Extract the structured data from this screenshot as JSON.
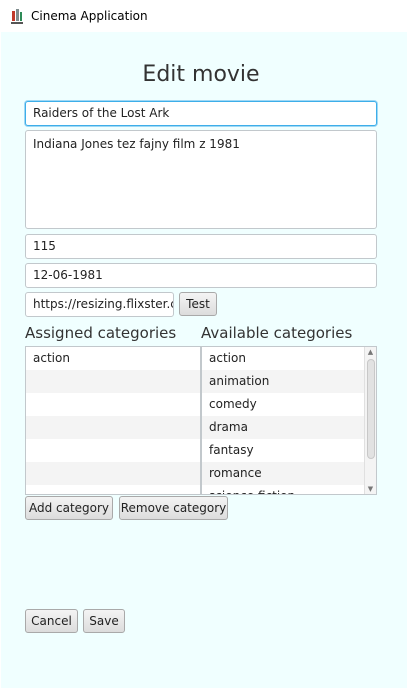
{
  "window": {
    "title": "Cinema Application",
    "icon": "cinema-app-icon"
  },
  "form": {
    "heading": "Edit movie",
    "title_value": "Raiders of the Lost Ark",
    "description_value": "Indiana Jones tez fajny film z 1981",
    "duration_value": "115",
    "release_date_value": "12-06-1981",
    "image_url_value": "https://resizing.flixster.com",
    "test_label": "Test"
  },
  "categories": {
    "assigned_label": "Assigned categories",
    "available_label": "Available categories",
    "assigned": [
      "action"
    ],
    "available": [
      "action",
      "animation",
      "comedy",
      "drama",
      "fantasy",
      "romance",
      "science fiction"
    ],
    "add_label": "Add category",
    "remove_label": "Remove category"
  },
  "actions": {
    "cancel_label": "Cancel",
    "save_label": "Save"
  },
  "colors": {
    "window_bg": "#f0ffff",
    "focus": "#3daee9"
  }
}
